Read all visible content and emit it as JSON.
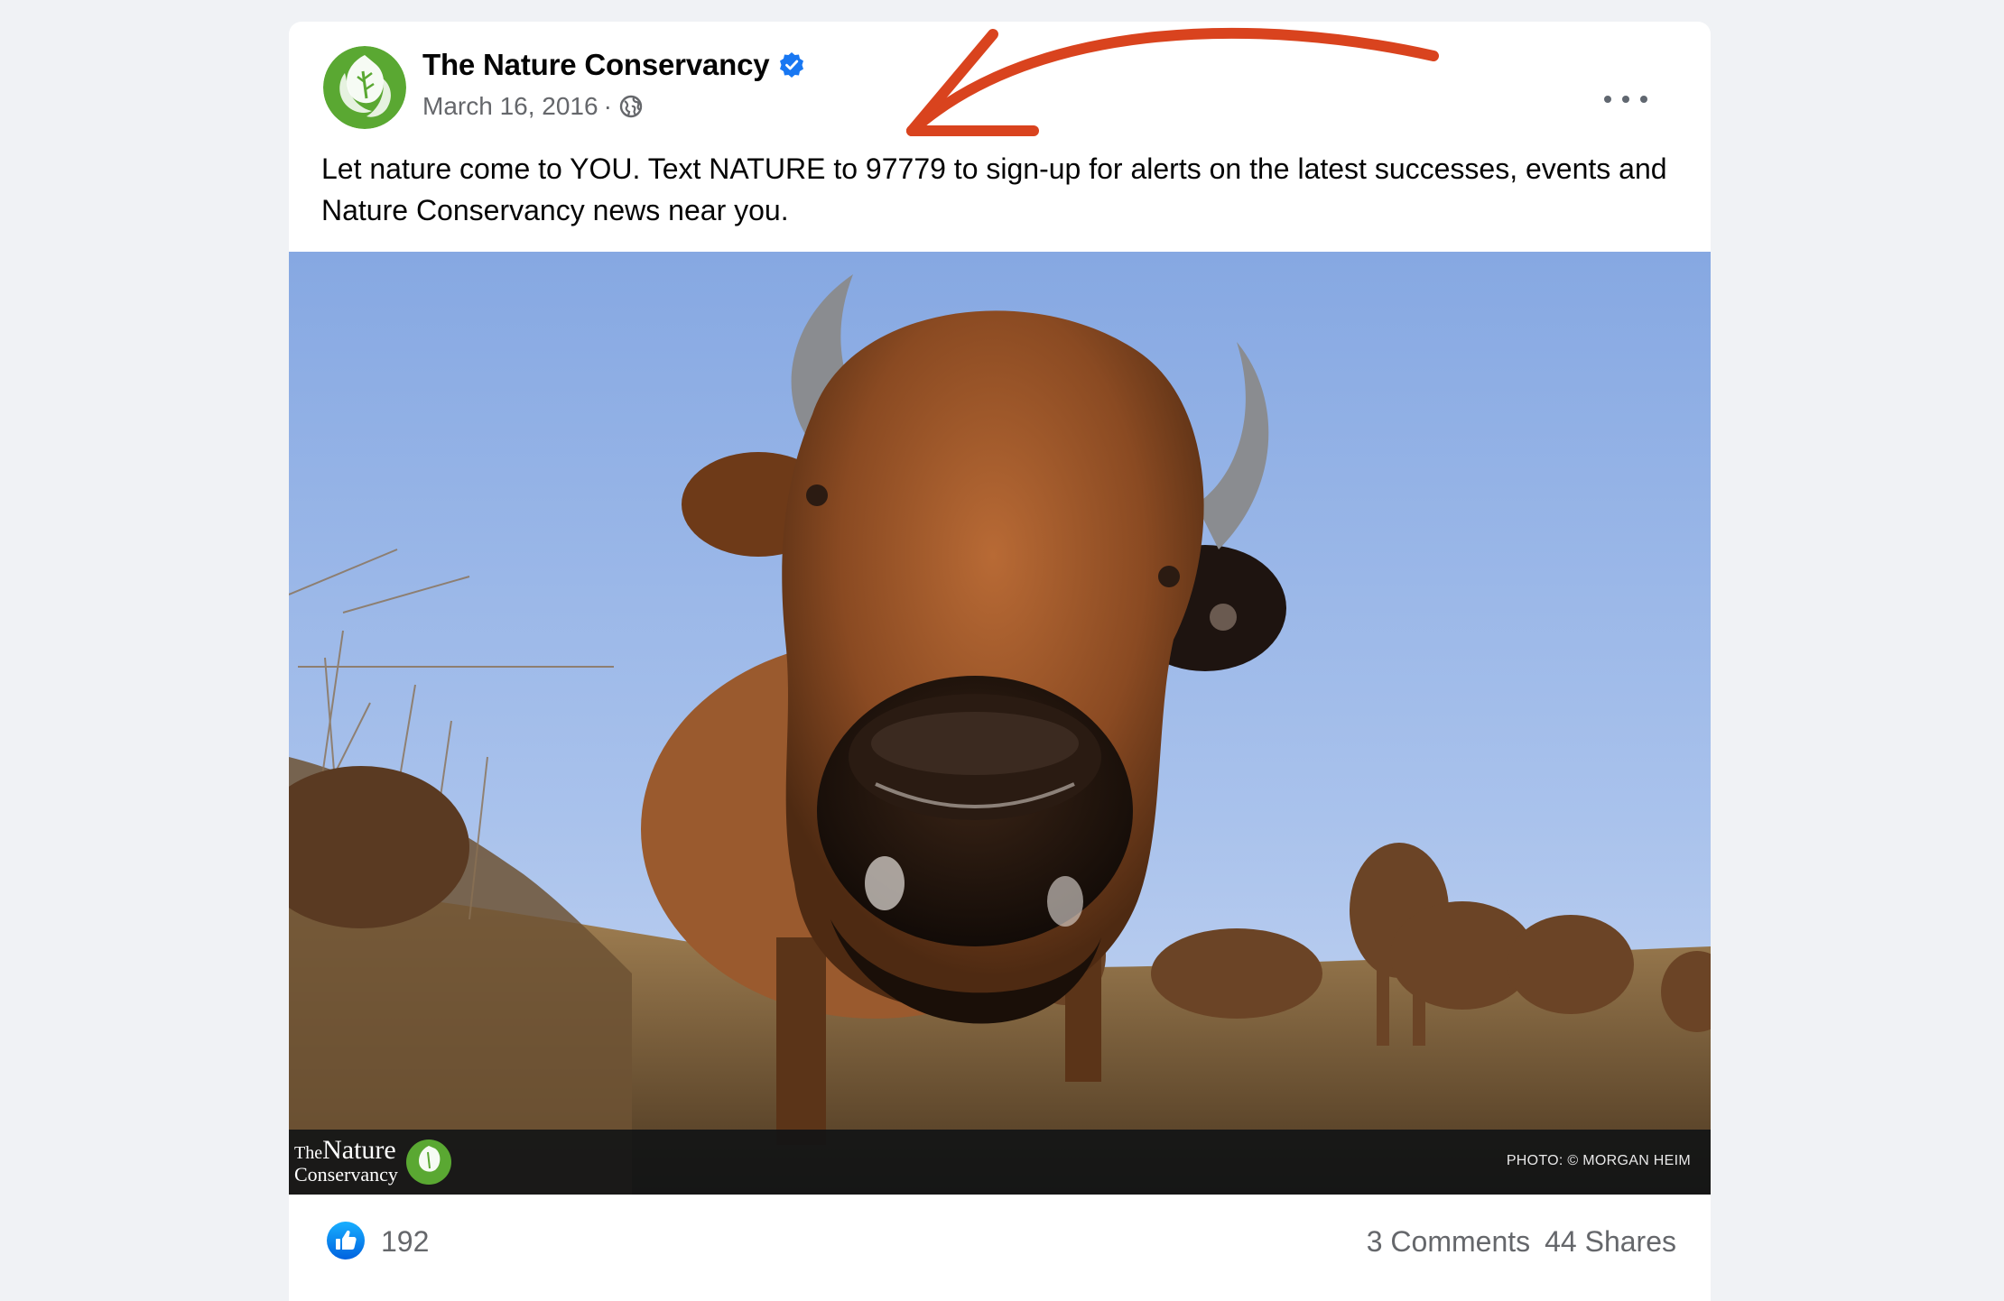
{
  "post": {
    "page_name": "The Nature Conservancy",
    "date": "March 16, 2016",
    "separator": "·",
    "privacy_icon": "globe-icon",
    "verified_icon": "verified-badge-icon",
    "more_icon": "more-options-icon",
    "text": "Let nature come to YOU. Text NATURE to 97779 to sign-up for alerts on the latest successes, events and Nature Conservancy news near you."
  },
  "photo": {
    "subject": "bison",
    "watermark": {
      "line1_the": "The",
      "line1_nature": "Nature",
      "line2": "Conservancy"
    },
    "credit": "PHOTO: © MORGAN HEIM"
  },
  "stats": {
    "like_icon": "thumbs-up-icon",
    "likes": "192",
    "comments": "3 Comments",
    "shares": "44 Shares"
  },
  "annotation": {
    "arrow_color": "#d9431e"
  },
  "colors": {
    "background": "#f0f2f5",
    "brand_green": "#5aa832",
    "facebook_blue": "#1877f2"
  }
}
